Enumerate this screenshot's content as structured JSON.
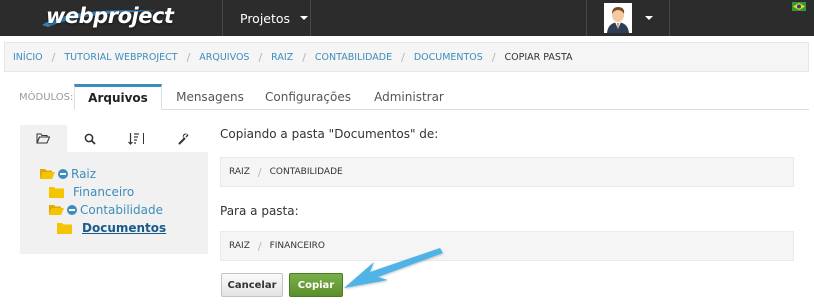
{
  "topbar": {
    "logo_text": "webproject",
    "projects_label": "Projetos"
  },
  "breadcrumb": {
    "items": [
      "INÍCIO",
      "TUTORIAL WEBPROJECT",
      "ARQUIVOS",
      "RAIZ",
      "CONTABILIDADE",
      "DOCUMENTOS"
    ],
    "current": "COPIAR PASTA",
    "separator": "/"
  },
  "modules": {
    "label": "MÓDULOS:",
    "tabs": [
      {
        "label": "Arquivos",
        "active": true
      },
      {
        "label": "Mensagens",
        "active": false
      },
      {
        "label": "Configurações",
        "active": false
      },
      {
        "label": "Administrar",
        "active": false
      }
    ]
  },
  "left_panel": {
    "tab_icons": [
      "folder-open-icon",
      "search-icon",
      "sort-icon",
      "wrench-icon"
    ],
    "tree": [
      {
        "label": "Raiz",
        "level": 0,
        "expanded": true
      },
      {
        "label": "Financeiro",
        "level": 1,
        "expanded": false
      },
      {
        "label": "Contabilidade",
        "level": 1,
        "expanded": true
      },
      {
        "label": "Documentos",
        "level": 2,
        "selected": true
      }
    ]
  },
  "main": {
    "copying_label": "Copiando a pasta \"Documentos\" de:",
    "source_path": [
      "RAIZ",
      "CONTABILIDADE"
    ],
    "target_label": "Para a pasta:",
    "target_path": [
      "RAIZ",
      "FINANCEIRO"
    ],
    "cancel_label": "Cancelar",
    "copy_label": "Copiar"
  },
  "colors": {
    "accent": "#3c8dbc",
    "copy_button": "#6aa03a",
    "topbar": "#2c2c2c",
    "folder": "#f5c400",
    "arrow": "#4fb3e8"
  }
}
